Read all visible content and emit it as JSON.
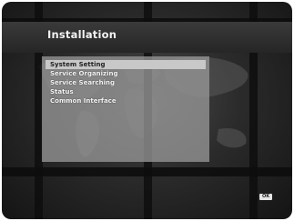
{
  "screen": {
    "title": "Installation",
    "menu": [
      {
        "label": "System Setting",
        "selected": true
      },
      {
        "label": "Service Organizing",
        "selected": false
      },
      {
        "label": "Service Searching",
        "selected": false
      },
      {
        "label": "Status",
        "selected": false
      },
      {
        "label": "Common Interface",
        "selected": false
      }
    ],
    "ok_label": "OK"
  },
  "colors": {
    "background": "#2b2b2b",
    "panel": "#969696",
    "selection": "#c8c8c8"
  }
}
